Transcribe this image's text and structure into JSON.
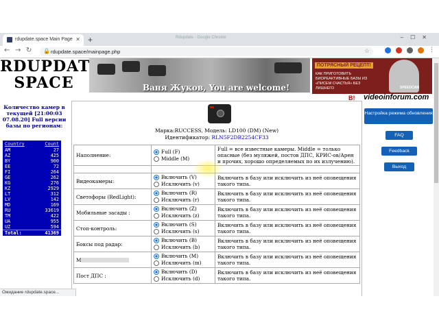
{
  "browser": {
    "tab_title": "rdupdate.space Main Page",
    "new_tab": "+",
    "window_title": "Rdupdate - Google Chrome",
    "url": "rdupdate.space/mainpage.php",
    "status_text": "Ожидание rdupdate.space..."
  },
  "header": {
    "logo_line1": "RDUPDATE",
    "logo_line2": "SPACE",
    "welcome": "Ваня Жуков, You are welcome!",
    "videoinforum": "videoinforum.com",
    "red_text": "В!",
    "ad_title": "ПОТРЯСНЫЙ РЕЦЕПТ!",
    "ad_text": "КАК ПРИГОТОВИТЬ БИОРЕАКТИВНЫЕ БАЗЫ ИЗ «ПИСЕМ СЧАСТЬЯ» БЕЗ ЛИШНЕГО",
    "ad_brand": "SPEEDCAM"
  },
  "left": {
    "count_heading": "Количество камер в текущей [21:00:03 07.08.20] Full версии базы по регионам:",
    "col_country": "Country",
    "col_count": "Count",
    "rows": [
      {
        "c": "AM",
        "n": "27"
      },
      {
        "c": "AZ",
        "n": "425"
      },
      {
        "c": "BY",
        "n": "900"
      },
      {
        "c": "EE",
        "n": "72"
      },
      {
        "c": "FI",
        "n": "264"
      },
      {
        "c": "GE",
        "n": "262"
      },
      {
        "c": "KG",
        "n": "276"
      },
      {
        "c": "KZ",
        "n": "2929"
      },
      {
        "c": "LT",
        "n": "312"
      },
      {
        "c": "LV",
        "n": "142"
      },
      {
        "c": "MD",
        "n": "169"
      },
      {
        "c": "RU",
        "n": "33619"
      },
      {
        "c": "TM",
        "n": "422"
      },
      {
        "c": "UA",
        "n": "955"
      },
      {
        "c": "UZ",
        "n": "594"
      }
    ],
    "total_label": "Total:",
    "total_value": "41369"
  },
  "main": {
    "model": "Марка:RUCCESS, Модель: LD100 (DM) (New)",
    "ident_label": "Идентификатор:",
    "ident_value": "RLN5F2DB2254CF33",
    "fill": {
      "label": "Наполнение:",
      "opt1": "Full (F)",
      "opt2": "Middle (M)",
      "desc": "Full = все известные камеры. Middle = только опасные (без муляжей, постов ДПС, КРИС-ов/Арен и прочих, хорошо определяемых по их излучению)."
    },
    "rows": [
      {
        "label": "Видеокамеры:",
        "inc": "Включить (V)",
        "exc": "Исключить (v)",
        "desc": "Включить в базу или исключить из неё оповещения такого типа."
      },
      {
        "label": "Светофоры (RedLight):",
        "inc": "Включить (R)",
        "exc": "Исключить (r)",
        "desc": "Включить в базу или исключить из неё оповещения такого типа."
      },
      {
        "label": "Мобильные засады :",
        "inc": "Включить (Z)",
        "exc": "Исключить (z)",
        "desc": "Включить в базу или исключить из неё оповещения такого типа."
      },
      {
        "label": "Стоп-контроль:",
        "inc": "Включить (S)",
        "exc": "Исключить (s)",
        "desc": "Включить в базу или исключить из неё оповещения такого типа."
      },
      {
        "label": "Боксы под радар:",
        "inc": "Включить (B)",
        "exc": "Исключить (b)",
        "desc": "Включить в базу или исключить из неё оповещения такого типа."
      },
      {
        "label": "М",
        "inc": "Включить (M)",
        "exc": "Исключить (m)",
        "desc": "Включить в базу или исключить из неё оповещения такого типа."
      },
      {
        "label": "Пост ДПС :",
        "inc": "Включить (D)",
        "exc": "Исключить (d)",
        "desc": "Включить в базу или исключить из неё оповещения такого типа."
      }
    ]
  },
  "right": {
    "settings": "Настройка режима обновления",
    "faq": "FAQ",
    "feedback": "Feedback",
    "exit": "Выход"
  }
}
